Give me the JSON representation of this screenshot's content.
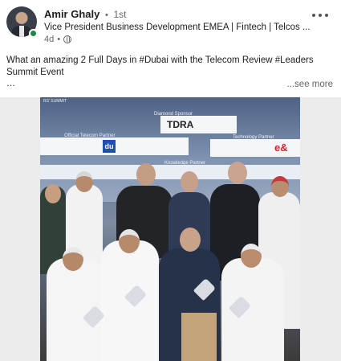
{
  "post": {
    "author_name": "Amir Ghaly",
    "separator": "•",
    "degree": "1st",
    "headline": "Vice President Business Development EMEA | Fintech | Telcos ...",
    "time": "4d",
    "time_separator": "•",
    "visibility_icon": "globe-icon",
    "text": "What an amazing 2 Full Days in #Dubai with the Telecom Review #Leaders Summit Event",
    "ellipsis": "…",
    "see_more": "...see more"
  },
  "media": {
    "banners": {
      "diamond_sponsor": "Diamond Sponsor",
      "diamond_logo": "TDRA",
      "official_telecom_partner": "Official Telecom Partner",
      "telecom_logo": "du",
      "technology_partner": "Technology Partner",
      "tech_logo": "e&",
      "knowledge_partner": "Knowledge Partner",
      "leaders_summit": "RS' SUMMIT"
    }
  },
  "colors": {
    "online_dot": "#1a8a43",
    "text_primary": "#1d1d1d",
    "text_secondary": "#666666",
    "media_bg": "#ebebeb"
  }
}
